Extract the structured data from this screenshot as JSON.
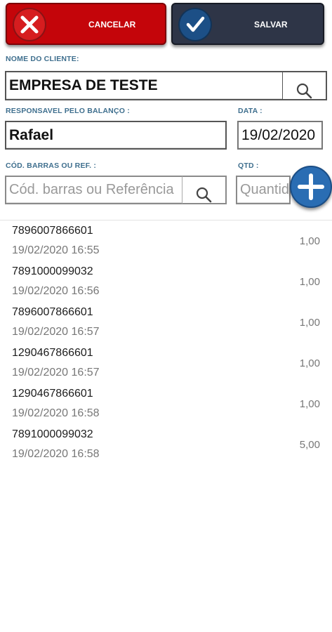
{
  "actions": {
    "cancel_label": "CANCELAR",
    "save_label": "SALVAR"
  },
  "form": {
    "client_label": "NOME DO CLIENTE:",
    "client_value": "EMPRESA DE TESTE",
    "responsible_label": "RESPONSAVEL PELO BALANÇO :",
    "responsible_value": "Rafael",
    "date_label": "DATA :",
    "date_value": "19/02/2020",
    "barcode_label": "CÓD. BARRAS OU REF. :",
    "barcode_placeholder": "Cód. barras ou Referência",
    "qty_label": "QTD :",
    "qty_placeholder": "Quantidade"
  },
  "items": [
    {
      "code": "7896007866601",
      "datetime": "19/02/2020 16:55",
      "qty": "1,00"
    },
    {
      "code": "7891000099032",
      "datetime": "19/02/2020 16:56",
      "qty": "1,00"
    },
    {
      "code": "7896007866601",
      "datetime": "19/02/2020 16:57",
      "qty": "1,00"
    },
    {
      "code": "1290467866601",
      "datetime": "19/02/2020 16:57",
      "qty": "1,00"
    },
    {
      "code": "1290467866601",
      "datetime": "19/02/2020 16:58",
      "qty": "1,00"
    },
    {
      "code": "7891000099032",
      "datetime": "19/02/2020 16:58",
      "qty": "5,00"
    }
  ],
  "icons": {
    "cancel": "close-icon",
    "save": "check-icon",
    "search": "search-icon",
    "add": "plus-icon"
  },
  "colors": {
    "cancel_bg": "#c4050a",
    "save_bg": "#2e3547",
    "label_blue": "#3f6f8e",
    "fab_blue": "#2a6db3"
  }
}
